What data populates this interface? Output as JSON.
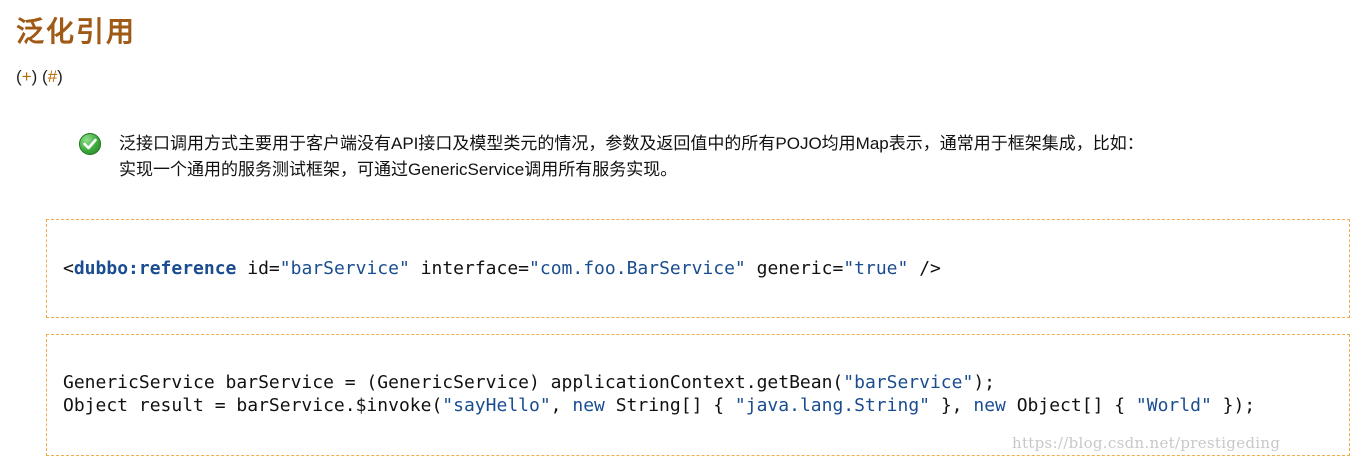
{
  "heading": "泛化引用",
  "links": {
    "open1": "(",
    "plus": "+",
    "close1": ")",
    "open2": "(",
    "hash": "#",
    "close2": ")"
  },
  "note": {
    "icon": "check-icon",
    "icon_color": "#3aa53a",
    "line1": "泛接口调用方式主要用于客户端没有API接口及模型类元的情况，参数及返回值中的所有POJO均用Map表示，通常用于框架集成，比如：",
    "line2": "实现一个通用的服务测试框架，可通过GenericService调用所有服务实现。"
  },
  "code1": {
    "t1": "<",
    "t2": "dubbo:reference",
    "t3": " id=",
    "t4": "\"barService\"",
    "t5": " interface=",
    "t6": "\"com.foo.BarService\"",
    "t7": " generic=",
    "t8": "\"true\"",
    "t9": " />"
  },
  "code2": {
    "a1": "GenericService barService = (GenericService) applicationContext.getBean(",
    "a2": "\"barService\"",
    "a3": ");",
    "b1": "Object result = barService.$invoke(",
    "b2": "\"sayHello\"",
    "b3": ", ",
    "b4": "new",
    "b5": " String[] { ",
    "b6": "\"java.lang.String\"",
    "b7": " }, ",
    "b8": "new",
    "b9": " Object[] { ",
    "b10": "\"World\"",
    "b11": " });"
  },
  "watermark": "https://blog.csdn.net/prestigeding",
  "colors": {
    "heading": "#a05a16",
    "link": "#b36a00",
    "border": "#f0ad4e",
    "code_accent": "#1a4d8f"
  }
}
